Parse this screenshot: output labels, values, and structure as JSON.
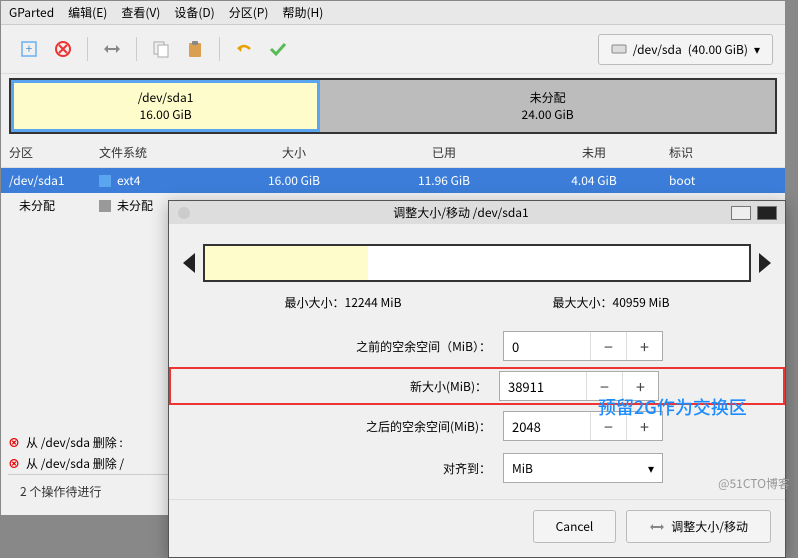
{
  "menubar": [
    "GParted",
    "编辑(E)",
    "查看(V)",
    "设备(D)",
    "分区(P)",
    "帮助(H)"
  ],
  "toolbar_icons": [
    "new-icon",
    "delete-icon",
    "sep",
    "resize-icon",
    "sep",
    "copy-icon",
    "paste-icon",
    "sep",
    "undo-icon",
    "apply-icon"
  ],
  "device": {
    "name": "/dev/sda",
    "size": "(40.00 GiB)"
  },
  "diskmap": {
    "p1": {
      "name": "/dev/sda1",
      "size": "16.00 GiB"
    },
    "p2": {
      "name": "未分配",
      "size": "24.00 GiB"
    }
  },
  "columns": {
    "part": "分区",
    "fs": "文件系统",
    "size": "大小",
    "used": "已用",
    "free": "未用",
    "flags": "标识"
  },
  "rows": [
    {
      "part": "/dev/sda1",
      "fs": "ext4",
      "size": "16.00 GiB",
      "used": "11.96 GiB",
      "free": "4.04 GiB",
      "flags": "boot",
      "sel": true
    },
    {
      "part": "未分配",
      "fs": "未分配",
      "size": "",
      "used": "",
      "free": "",
      "flags": "",
      "sel": false
    }
  ],
  "pending": [
    "从 /dev/sda 删除 :",
    "从 /dev/sda 删除 /"
  ],
  "status": "2 个操作待进行",
  "dialog": {
    "title": "调整大小/移动 /dev/sda1",
    "min": "最小大小：12244 MiB",
    "max": "最大大小：40959 MiB",
    "before_label": "之前的空余空间（MiB）：",
    "before_val": "0",
    "newsize_label": "新大小(MiB)：",
    "newsize_val": "38911",
    "after_label": "之后的空余空间(MiB)：",
    "after_val": "2048",
    "align_label": "对齐到：",
    "align_val": "MiB",
    "cancel": "Cancel",
    "apply": "调整大小/移动"
  },
  "annotation": "预留2G作为交换区",
  "watermark": "@51CTO博客"
}
